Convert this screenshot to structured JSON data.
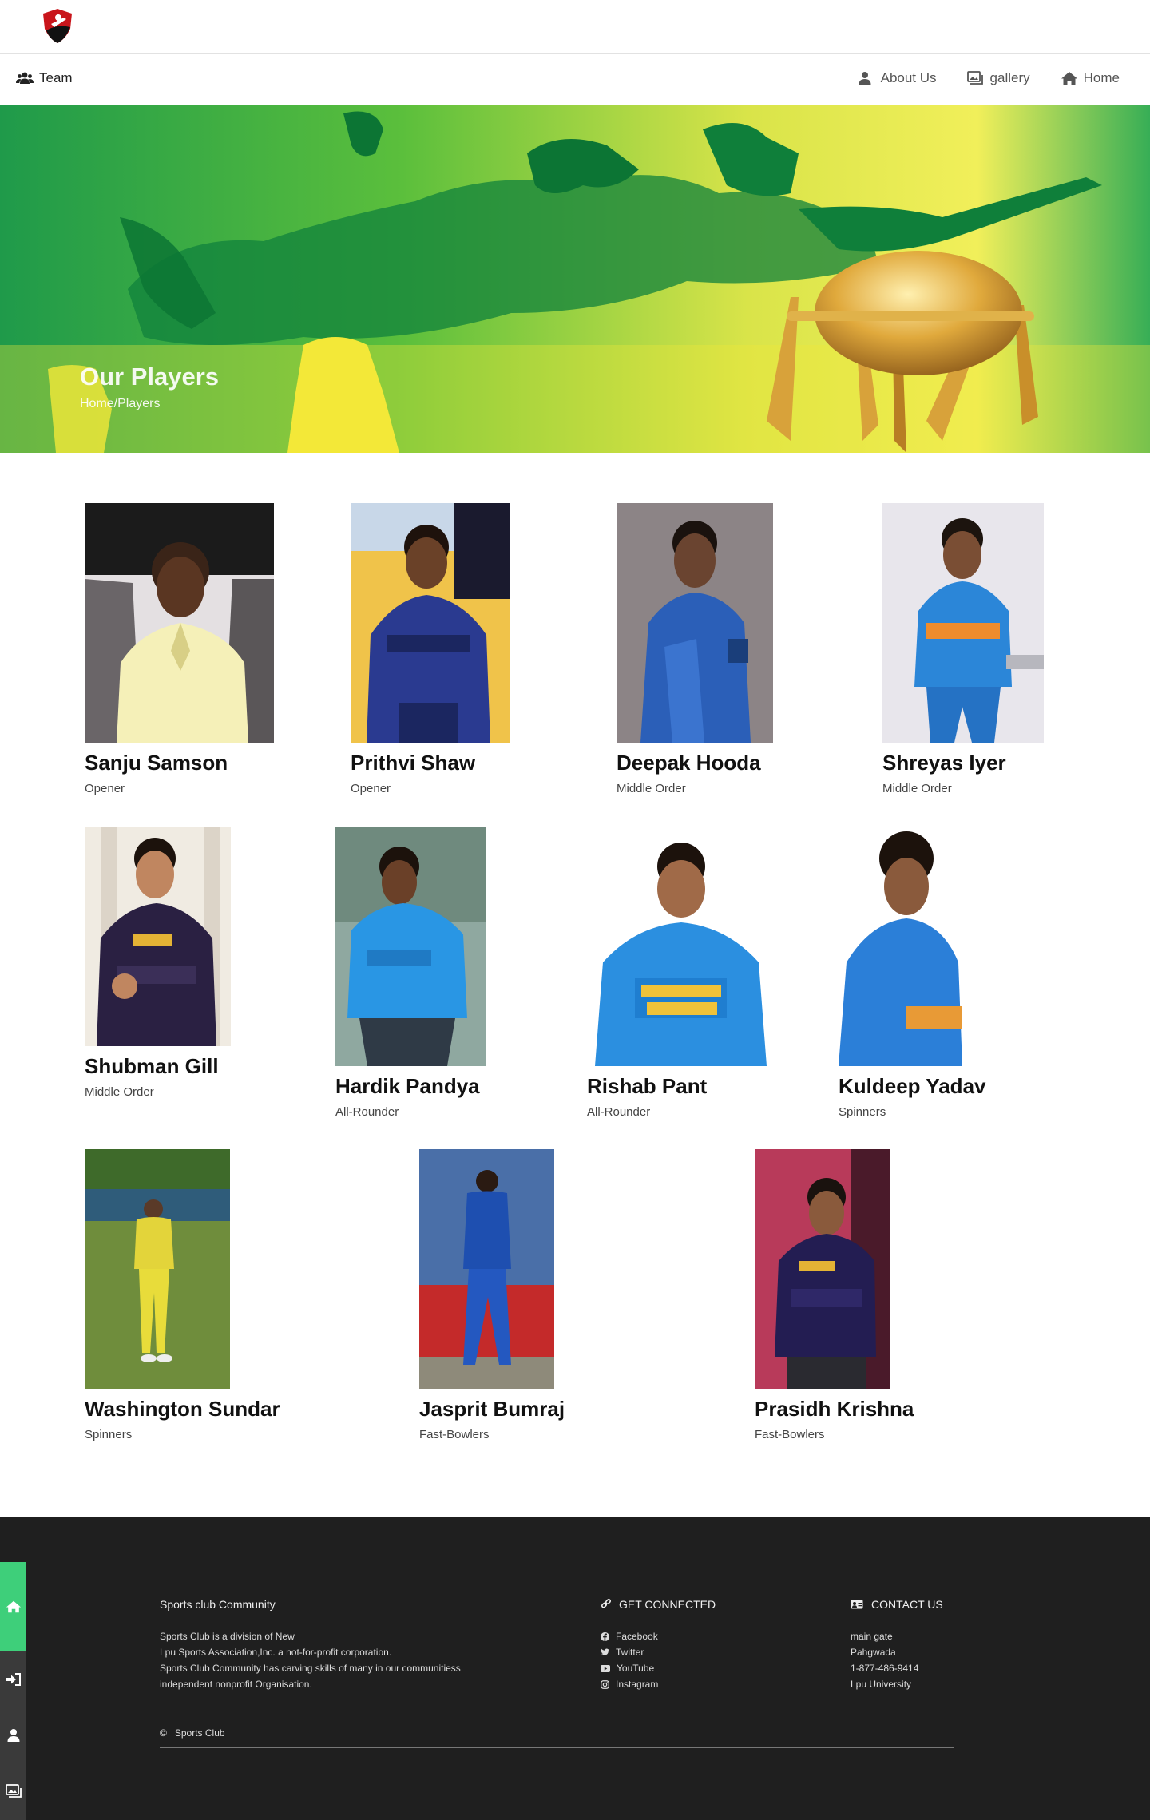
{
  "navbar": {
    "team_label": "Team",
    "about_label": "About Us",
    "gallery_label": "gallery",
    "home_label": "Home"
  },
  "hero": {
    "title": "Our Players",
    "breadcrumb": "Home/Players"
  },
  "players": [
    {
      "name": "Sanju Samson",
      "role": "Opener"
    },
    {
      "name": "Prithvi Shaw",
      "role": "Opener"
    },
    {
      "name": "Deepak Hooda",
      "role": "Middle Order"
    },
    {
      "name": "Shreyas Iyer",
      "role": "Middle Order"
    },
    {
      "name": "Shubman Gill",
      "role": "Middle Order"
    },
    {
      "name": "Hardik Pandya",
      "role": "All-Rounder"
    },
    {
      "name": "Rishab Pant",
      "role": "All-Rounder"
    },
    {
      "name": "Kuldeep Yadav",
      "role": "Spinners"
    },
    {
      "name": "Washington Sundar",
      "role": "Spinners"
    },
    {
      "name": "Jasprit Bumraj",
      "role": "Fast-Bowlers"
    },
    {
      "name": "Prasidh Krishna",
      "role": "Fast-Bowlers"
    }
  ],
  "footer": {
    "about_title": "Sports club Community",
    "about_lines": [
      "Sports Club is a division of New",
      "Lpu Sports Association,Inc. a not-for-profit corporation.",
      "Sports Club Community has carving skills of many in our communitiess",
      "independent nonprofit Organisation."
    ],
    "connect_title": "GET CONNECTED",
    "social": [
      "Facebook",
      "Twitter",
      "YouTube",
      "Instagram"
    ],
    "contact_title": "CONTACT US",
    "contact_lines": [
      "main gate",
      "Pahgwada",
      "1-877-486-9414",
      "Lpu University"
    ],
    "copyright_symbol": "©",
    "copyright_text": "Sports Club"
  },
  "colors": {
    "footer_bg": "#1f1f1f",
    "rail_active": "#3ecf7a",
    "hero_green": "#1f9a4a",
    "hero_yellow": "#f2e84a"
  }
}
